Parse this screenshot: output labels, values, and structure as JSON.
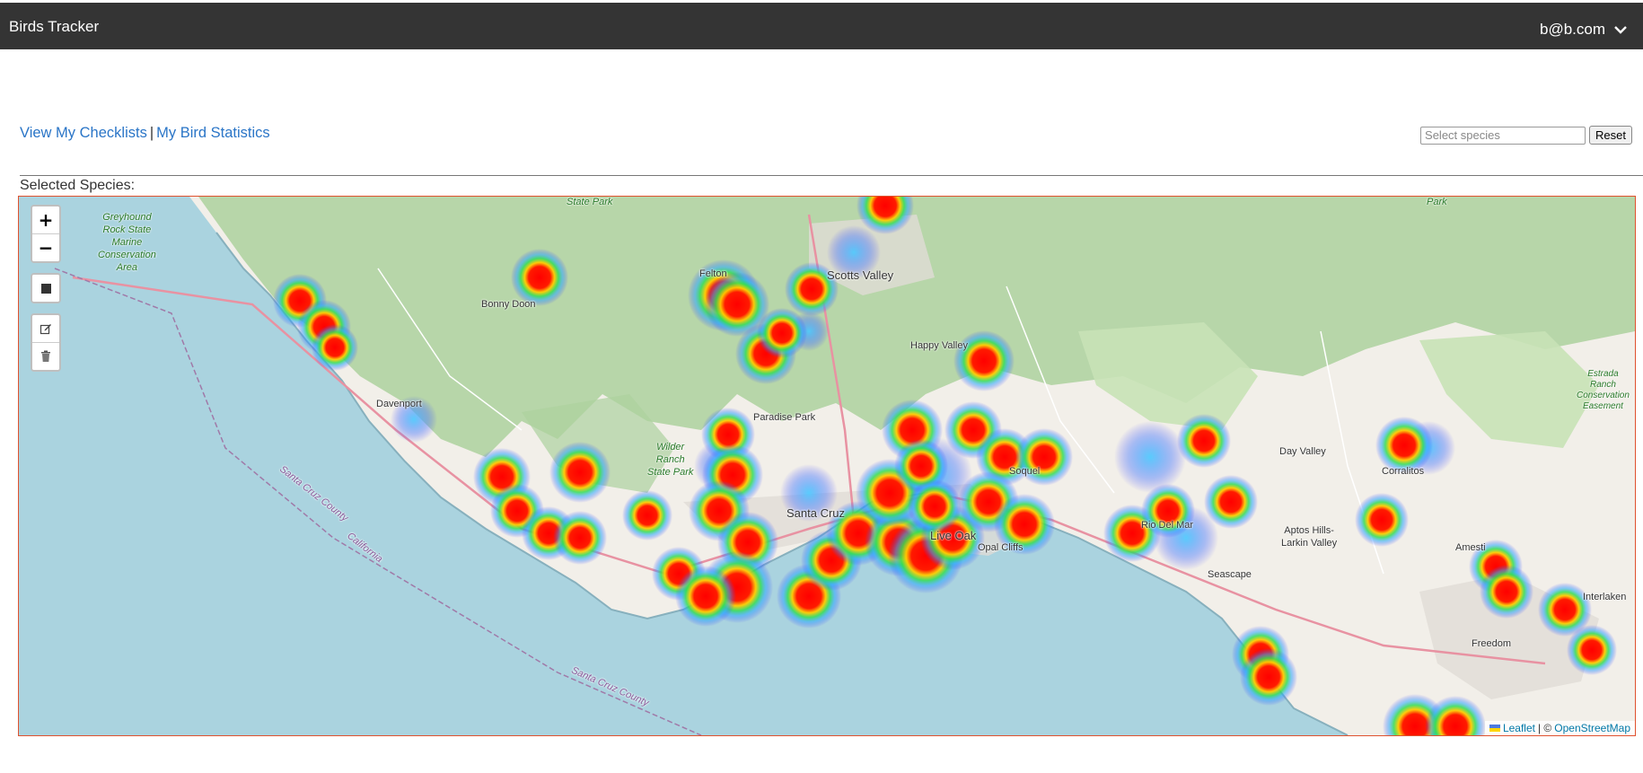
{
  "header": {
    "title": "Birds Tracker",
    "user_email": "b@b.com"
  },
  "nav": {
    "checklists_link": "View My Checklists",
    "separator": "|",
    "statistics_link": "My Bird Statistics"
  },
  "species": {
    "placeholder": "Select species",
    "reset_label": "Reset"
  },
  "selected_species_label": "Selected Species:",
  "map": {
    "zoom_in": "+",
    "zoom_out": "−",
    "attribution": {
      "leaflet": "Leaflet",
      "separator": "| ©",
      "osm": "OpenStreetMap"
    },
    "places": {
      "greyhound": "Greyhound\nRock State\nMarine\nConservation\nArea",
      "state_park": "State Park",
      "bonny_doon": "Bonny Doon",
      "scotts_valley": "Scotts Valley",
      "felton": "Felton",
      "happy_valley": "Happy Valley",
      "davenport": "Davenport",
      "paradise_park": "Paradise Park",
      "wilder": "Wilder\nRanch\nState Park",
      "santa_cruz": "Santa Cruz",
      "live_oak": "Live Oak",
      "soquel": "Soquel",
      "opal_cliffs": "Opal Cliffs",
      "day_valley": "Day Valley",
      "corralitos": "Corralitos",
      "aptos_hills": "Aptos Hills-\nLarkin Valley",
      "seascape": "Seascape",
      "rio_del_mar": "Rio Del Mar",
      "freedom": "Freedom",
      "interlaken": "Interlaken",
      "amesti": "Amesti",
      "estrada": "Estrada\nRanch\nConservation\nEasement",
      "park": "Park",
      "scc_1": "Santa Cruz County",
      "california": "California",
      "scc_2": "Santa Cruz County"
    }
  },
  "colors": {
    "topbar": "#343434",
    "link": "#2a75c7",
    "map_border": "#e0522f",
    "water": "#aad3df",
    "land": "#f2efe9",
    "forest": "#add19e"
  }
}
